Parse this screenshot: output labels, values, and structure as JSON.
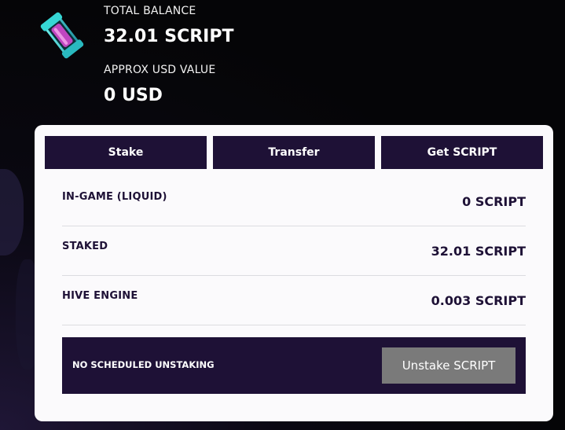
{
  "header": {
    "icon": "script-token-capsule-icon",
    "total_balance_label": "TOTAL BALANCE",
    "total_balance_value": "32.01 SCRIPT",
    "usd_label": "APPROX USD VALUE",
    "usd_value": "0 USD"
  },
  "tabs": [
    {
      "label": "Stake"
    },
    {
      "label": "Transfer"
    },
    {
      "label": "Get SCRIPT"
    }
  ],
  "rows": [
    {
      "label": "IN-GAME (LIQUID)",
      "value": "0 SCRIPT"
    },
    {
      "label": "STAKED",
      "value": "32.01 SCRIPT"
    },
    {
      "label": "HIVE ENGINE",
      "value": "0.003 SCRIPT"
    }
  ],
  "unstaking": {
    "status": "NO SCHEDULED UNSTAKING",
    "button_label": "Unstake SCRIPT"
  },
  "colors": {
    "panel_dark": "#1e1136",
    "card_bg": "#fbfafc",
    "disabled_button": "#7a7a7a",
    "capsule_glow": "#3ee6e0",
    "capsule_core": "#e04ad8"
  }
}
